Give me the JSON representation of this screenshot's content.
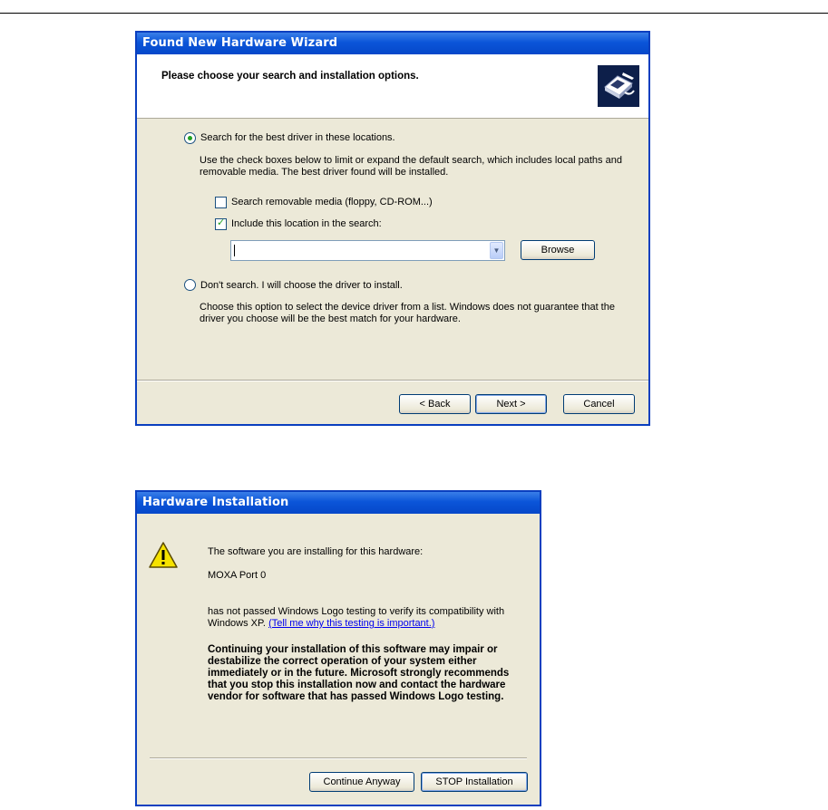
{
  "wizard": {
    "title": "Found New Hardware Wizard",
    "heading": "Please choose your search and installation options.",
    "option_search": "Search for the best driver in these locations.",
    "search_desc": "Use the check boxes below to limit or expand the default search, which includes local paths and removable media. The best driver found will be installed.",
    "removable_media": "Search removable media (floppy, CD-ROM...)",
    "removable_checked": false,
    "include_location": "Include this location in the search:",
    "include_checked": true,
    "location_value": "",
    "browse": "Browse",
    "option_dont_search": "Don't search. I will choose the driver to install.",
    "dont_search_desc": "Choose this option to select the device driver from a list.  Windows does not guarantee that the driver you choose will be the best match for your hardware.",
    "back": "< Back",
    "next": "Next >",
    "cancel": "Cancel"
  },
  "install": {
    "title": "Hardware Installation",
    "line1": "The software you are installing for this hardware:",
    "device": "MOXA Port 0",
    "line2": "has not passed Windows Logo testing to verify its compatibility with Windows XP.",
    "link": "(Tell me why this testing is important.)",
    "warning": "Continuing your installation of this software may impair or destabilize the correct operation of your system either immediately or in the future. Microsoft strongly recommends that you stop this installation now and contact the hardware vendor for software that has passed Windows Logo testing.",
    "continue": "Continue Anyway",
    "stop": "STOP Installation"
  },
  "icons": [
    "hardware-wizard-icon",
    "warning-icon",
    "dropdown-arrow-icon"
  ]
}
